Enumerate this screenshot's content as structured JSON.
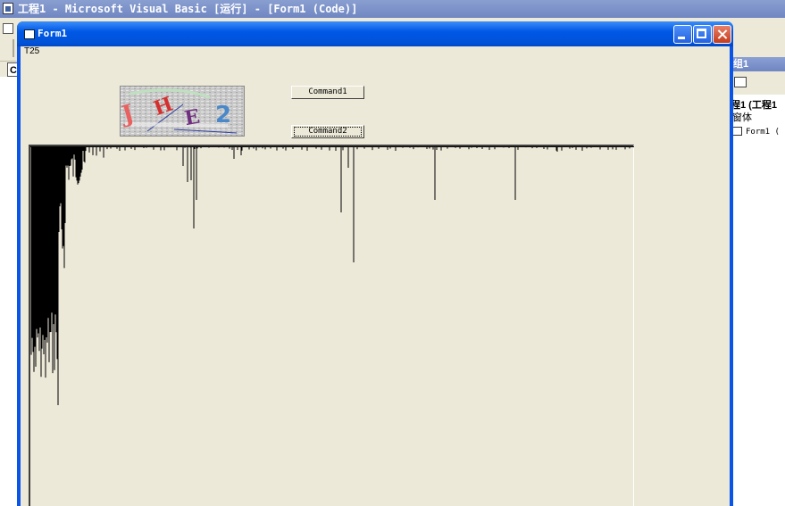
{
  "ide": {
    "title": "工程1 - Microsoft Visual Basic [运行] - [Form1 (Code)]"
  },
  "project_explorer": {
    "title_fragment": "组1",
    "tree_row1": "程1 (工程1",
    "tree_row2": "窗体",
    "tree_row3": "Form1 ("
  },
  "left_fragment": "C",
  "form": {
    "title": "Form1",
    "label_text": "T25",
    "command1_label": "Command1",
    "command2_label": "Command2",
    "captcha_letters": [
      "J",
      "H",
      "E",
      "2"
    ]
  },
  "colors": {
    "xp_title_blue": "#0058e6",
    "form_bg": "#ece9d8",
    "histogram_ink": "#000000"
  }
}
